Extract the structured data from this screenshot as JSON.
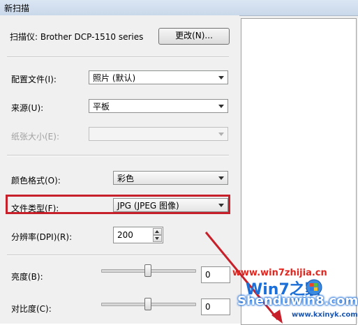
{
  "window": {
    "title": "新扫描"
  },
  "scanner": {
    "label": "扫描仪: Brother DCP-1510 series",
    "change_button": "更改(N)..."
  },
  "profile": {
    "label": "配置文件(I):",
    "value": "照片 (默认)"
  },
  "source": {
    "label": "来源(U):",
    "value": "平板"
  },
  "paper_size": {
    "label": "纸张大小(E):",
    "value": ""
  },
  "color_format": {
    "label": "颜色格式(O):",
    "value": "彩色"
  },
  "file_type": {
    "label": "文件类型(F):",
    "value": "JPG (JPEG 图像)"
  },
  "resolution": {
    "label": "分辨率(DPI)(R):",
    "value": "200"
  },
  "brightness": {
    "label": "亮度(B):",
    "value": "0",
    "level": 0.5
  },
  "contrast": {
    "label": "对比度(C):",
    "value": "0",
    "level": 0.5
  },
  "watermark": {
    "url_text": "www.win7zhijia.cn",
    "brand_text": "Shenduwin8.com",
    "sub_text": "www.kxinyk.com",
    "logo_text": "Win7之家"
  },
  "colors": {
    "highlight": "#c8202a",
    "watermark_red": "#e0261f",
    "watermark_blue": "#1d6fd8"
  }
}
